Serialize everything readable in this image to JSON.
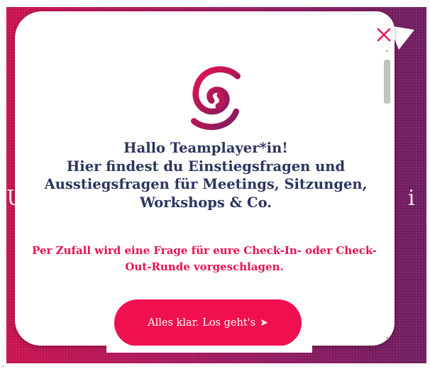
{
  "background": {
    "left_char": "U",
    "right_char": "i"
  },
  "modal": {
    "close_icon": "close-icon",
    "logo_icon": "spiral-logo-icon",
    "heading_lines": [
      "Hallo Teamplayer*in!",
      "Hier findest du Einstiegsfragen und",
      "Ausstiegsfragen für Meetings, Sitzungen,",
      "Workshops & Co."
    ],
    "random_lines": [
      "Per Zufall wird eine Frage für eure Check-In- oder Check-",
      "Out-Runde vorgeschlagen."
    ],
    "button_label": "Alles klar. Los geht's",
    "button_arrow": "➤"
  },
  "scrollbar": {
    "up_arrow": "˄",
    "down_arrow": "˅"
  },
  "colors": {
    "accent": "#f0104f",
    "heading": "#2c3660",
    "background_start": "#c8124e",
    "background_end": "#6d1c60"
  }
}
